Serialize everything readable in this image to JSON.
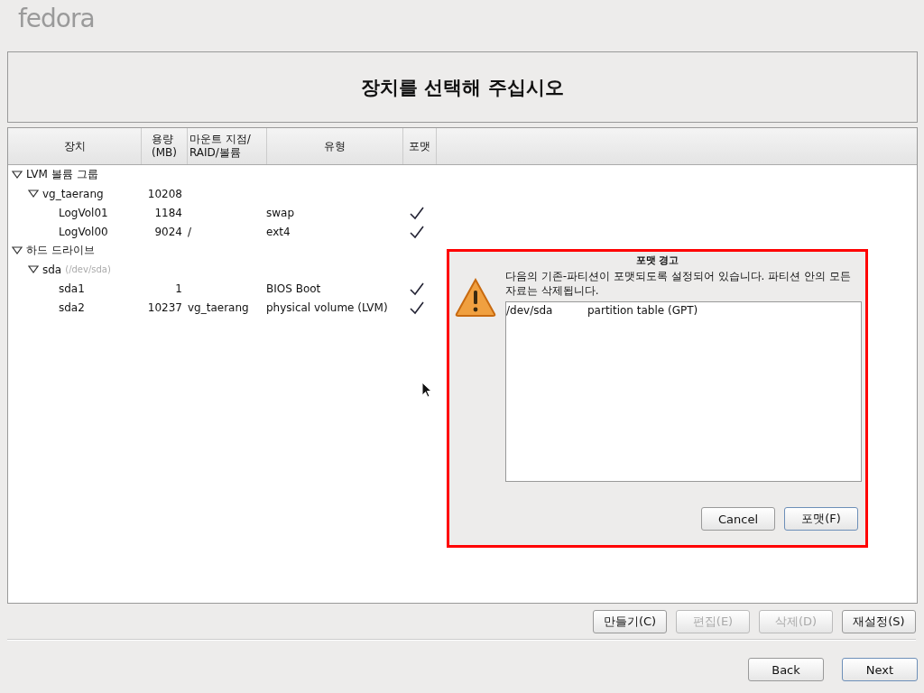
{
  "logo": "fedora",
  "header": {
    "title": "장치를 선택해 주십시오"
  },
  "table": {
    "columns": [
      "장치",
      "용량\n(MB)",
      "마운트 지점/\nRAID/볼륨",
      "유형",
      "포맷"
    ],
    "rows": [
      {
        "name": "LVM 볼륨 그룹",
        "expanded": true,
        "children": [
          {
            "name": "vg_taerang",
            "size": "10208",
            "expanded": true,
            "children": [
              {
                "name": "LogVol01",
                "size": "1184",
                "type": "swap",
                "format": true
              },
              {
                "name": "LogVol00",
                "size": "9024",
                "mount": "/",
                "type": "ext4",
                "format": true
              }
            ]
          }
        ]
      },
      {
        "name": "하드 드라이브",
        "expanded": true,
        "children": [
          {
            "name": "sda",
            "hint": "(/dev/sda)",
            "expanded": true,
            "children": [
              {
                "name": "sda1",
                "size": "1",
                "type": "BIOS Boot",
                "format": true
              },
              {
                "name": "sda2",
                "size": "10237",
                "mount": "vg_taerang",
                "type": "physical volume (LVM)",
                "format": true
              }
            ]
          }
        ]
      }
    ]
  },
  "dialog": {
    "title": "포맷 경고",
    "message": "다음의 기존-파티션이 포맷되도록 설정되어 있습니다. 파티션 안의 모든 자료는 삭제됩니다.",
    "items": [
      {
        "device": "/dev/sda",
        "description": "partition table (GPT)"
      }
    ],
    "buttons": [
      {
        "label": "Cancel",
        "default": false
      },
      {
        "label": "포맷(F)",
        "default": true
      }
    ]
  },
  "actions": [
    {
      "label": "만들기(C)",
      "disabled": false
    },
    {
      "label": "편집(E)",
      "disabled": true
    },
    {
      "label": "삭제(D)",
      "disabled": true
    },
    {
      "label": "재설정(S)",
      "disabled": false
    }
  ],
  "nav": [
    {
      "label": "Back",
      "default": false
    },
    {
      "label": "Next",
      "default": true
    }
  ]
}
